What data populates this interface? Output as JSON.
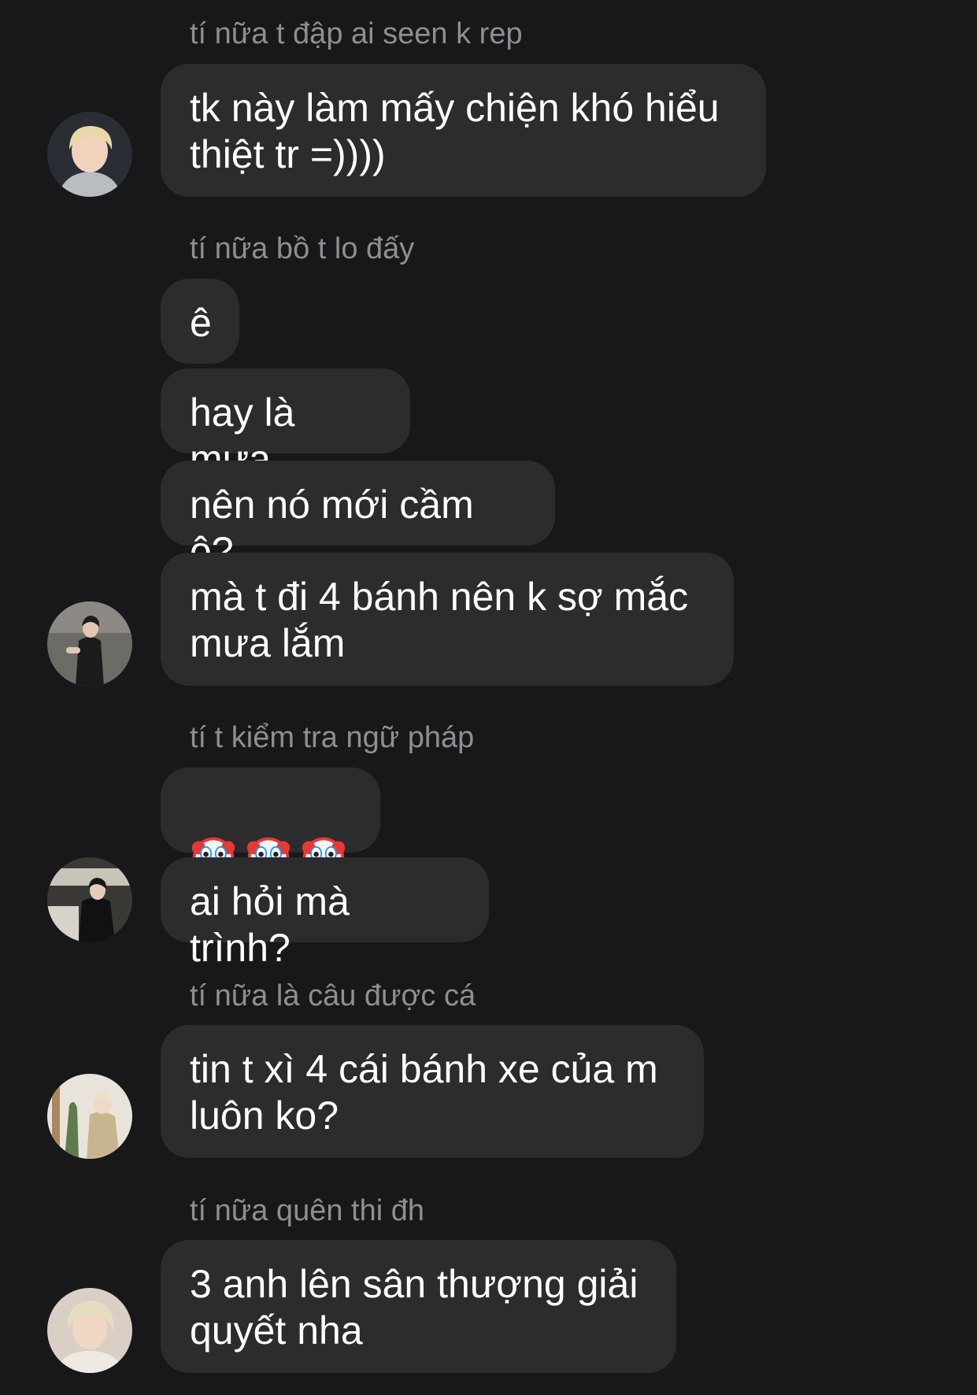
{
  "messages": [
    {
      "nickname": "tí nữa t đập ai seen k rep",
      "text": "tk này làm mấy chiện khó hiểu\nthiệt tr =))))"
    },
    {
      "nickname": "tí nữa bồ t lo đấy",
      "texts": [
        "ê",
        "hay là mưa",
        "nên nó mới cầm ô?",
        "mà t đi 4 bánh nên k sợ mắc\nmưa lắm"
      ]
    },
    {
      "nickname": "tí t kiểm tra ngữ pháp",
      "emoji": [
        "clown-face",
        "clown-face",
        "clown-face"
      ],
      "text": "ai hỏi mà trình?"
    },
    {
      "nickname": "tí nữa là câu được cá",
      "text": "tin t xì 4 cái bánh xe của m\nluôn ko?"
    },
    {
      "nickname": "tí nữa quên thi đh",
      "text": "3 anh lên sân thượng giải\nquyết nha"
    }
  ],
  "colors": {
    "background": "#18181b",
    "bubble": "#2c2c2e",
    "nickname": "#8e8e93",
    "text": "#ffffff"
  }
}
